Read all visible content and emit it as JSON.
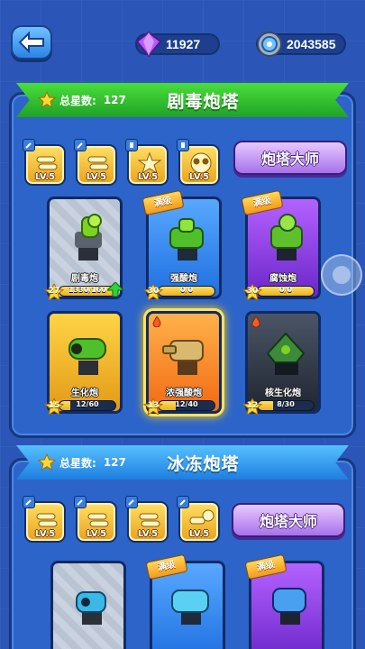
{
  "currency": {
    "gems": "11927",
    "coins": "2043585",
    "gem_color": "#b65bff",
    "coin_color": "#9fb2c8"
  },
  "poison_section": {
    "title": "剧毒炮塔",
    "stars_label": "总星数:",
    "stars_value": "127",
    "master_label": "炮塔大师",
    "upgrades": [
      {
        "level": "LV.5",
        "icon": "bullets-icon",
        "badge": "wrench-icon"
      },
      {
        "level": "LV.5",
        "icon": "bullets-icon",
        "badge": "wrench-icon"
      },
      {
        "level": "LV.5",
        "icon": "star-burst-icon",
        "badge": "chess-piece-icon"
      },
      {
        "level": "LV.5",
        "icon": "goggles-skull-icon",
        "badge": "chess-piece-icon"
      }
    ],
    "towers": [
      {
        "name": "剧毒炮",
        "stars": "27",
        "progress": "1330/160",
        "fill": 1.0,
        "frame": "gray",
        "maxed": false,
        "upgradable": true
      },
      {
        "name": "强酸炮",
        "stars": "30",
        "progress": "0/0",
        "fill": 1.0,
        "frame": "blue",
        "maxed": true,
        "max_label": "满级"
      },
      {
        "name": "腐蚀炮",
        "stars": "30",
        "progress": "0/0",
        "fill": 1.0,
        "frame": "purple",
        "maxed": true,
        "max_label": "满级"
      },
      {
        "name": "生化炮",
        "stars": "15",
        "progress": "12/60",
        "fill": 0.2,
        "frame": "gold",
        "maxed": false
      },
      {
        "name": "浓强酸炮",
        "stars": "13",
        "progress": "12/40",
        "fill": 0.3,
        "frame": "orange",
        "maxed": false,
        "selected": true
      },
      {
        "name": "核生化炮",
        "stars": "12",
        "progress": "8/30",
        "fill": 0.27,
        "frame": "dark",
        "maxed": false
      }
    ]
  },
  "ice_section": {
    "title": "冰冻炮塔",
    "stars_label": "总星数:",
    "stars_value": "127",
    "master_label": "炮塔大师",
    "upgrades": [
      {
        "level": "LV.5",
        "icon": "bullets-icon",
        "badge": "wrench-icon"
      },
      {
        "level": "LV.5",
        "icon": "bullets-icon",
        "badge": "wrench-icon"
      },
      {
        "level": "LV.5",
        "icon": "bullets-icon",
        "badge": "wrench-icon"
      },
      {
        "level": "LV.5",
        "icon": "snowflake-bullet-icon",
        "badge": "wrench-icon"
      }
    ],
    "towers": [
      {
        "frame": "gray",
        "maxed": false
      },
      {
        "frame": "blue",
        "maxed": true,
        "max_label": "满级"
      },
      {
        "frame": "purple",
        "maxed": true,
        "max_label": "满级"
      }
    ]
  }
}
